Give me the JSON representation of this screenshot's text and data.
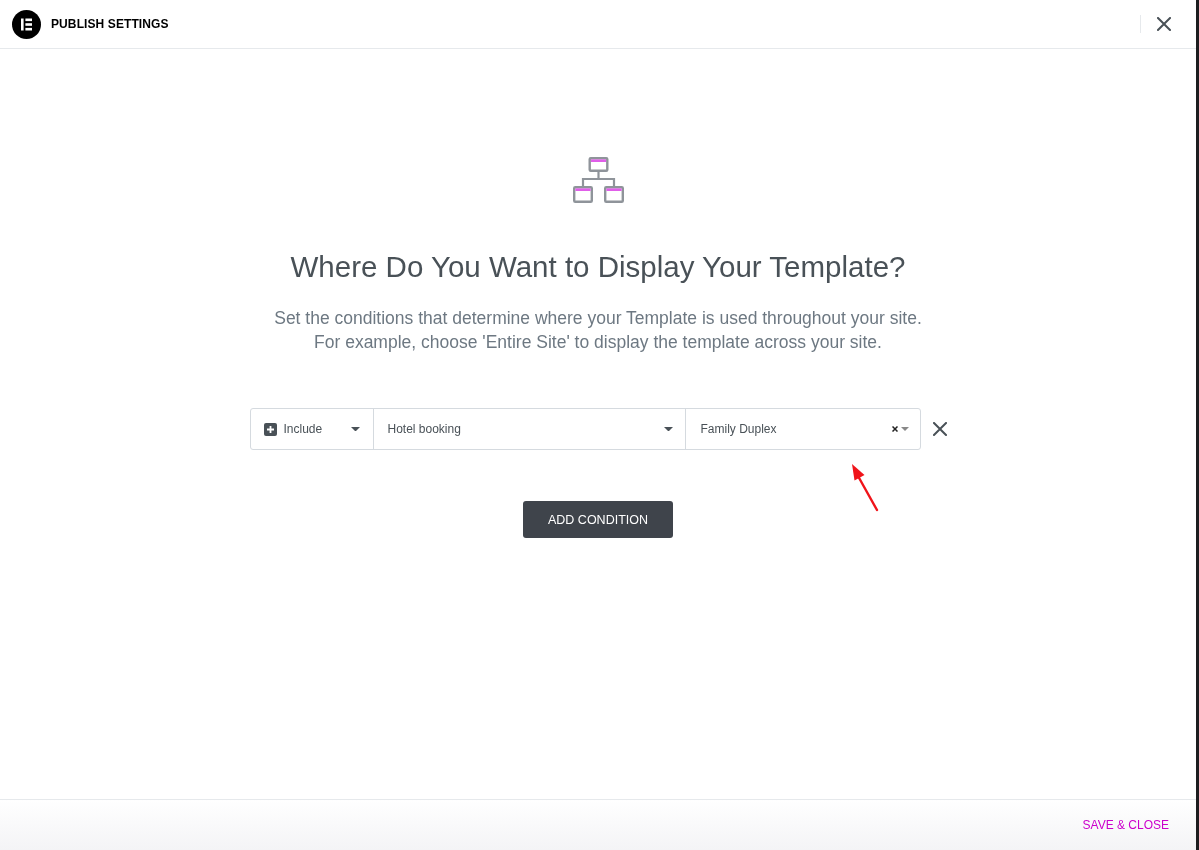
{
  "header": {
    "title": "PUBLISH SETTINGS"
  },
  "intro": {
    "heading": "Where Do You Want to Display Your Template?",
    "description": [
      "Set the conditions that determine where your Template is used throughout your site.",
      "For example, choose 'Entire Site' to display the template across your site."
    ]
  },
  "conditions": [
    {
      "type": "Include",
      "rule": "Hotel booking",
      "item": "Family Duplex"
    }
  ],
  "add_button": "ADD CONDITION",
  "footer": {
    "save_button": "SAVE & CLOSE"
  }
}
